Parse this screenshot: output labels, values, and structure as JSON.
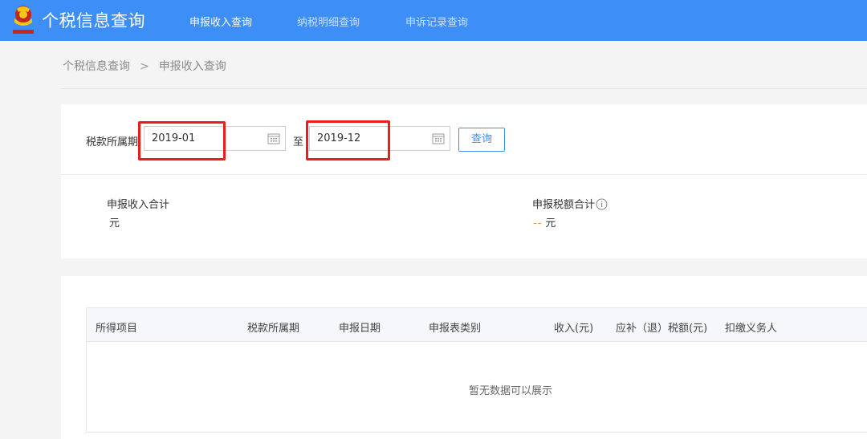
{
  "header": {
    "app_title": "个税信息查询",
    "nav": [
      {
        "label": "申报收入查询",
        "active": true
      },
      {
        "label": "纳税明细查询",
        "active": false
      },
      {
        "label": "申诉记录查询",
        "active": false
      }
    ],
    "accent_color": "#3e8ef7"
  },
  "breadcrumb": {
    "parent": "个税信息查询",
    "separator": ">",
    "current": "申报收入查询"
  },
  "filter": {
    "label": "税款所属期",
    "start_value": "2019-01",
    "range_separator": "至",
    "end_value": "2019-12",
    "query_button": "查询",
    "highlight_color": "#e8201a"
  },
  "summary": {
    "income_total_label": "申报收入合计",
    "income_total_unit": "元",
    "tax_total_label": "申报税额合计",
    "tax_total_value": "--",
    "tax_total_unit": "元"
  },
  "table": {
    "columns": [
      "所得项目",
      "税款所属期",
      "申报日期",
      "申报表类别",
      "收入(元)",
      "应补（退）税额(元)",
      "扣缴义务人"
    ],
    "rows": [],
    "empty_text": "暂无数据可以展示"
  }
}
